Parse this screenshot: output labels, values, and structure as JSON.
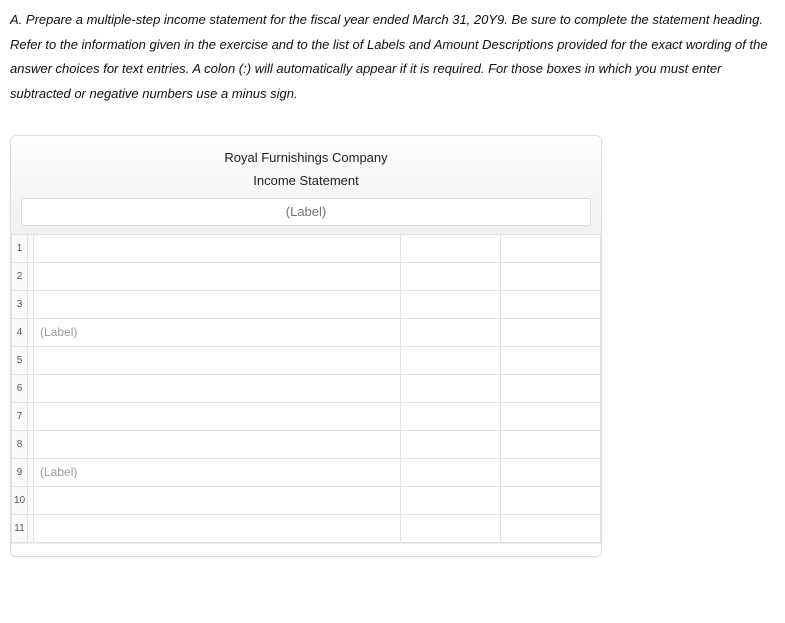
{
  "instructions": "A. Prepare a multiple-step income statement for the fiscal year ended March 31, 20Y9. Be sure to complete the statement heading. Refer to the information given in the exercise and to the list of Labels and Amount Descriptions provided for the exact wording of the answer choices for text entries. A colon (:) will automatically appear if it is required. For those boxes in which you must enter subtracted or negative numbers use a minus sign.",
  "statement": {
    "company": "Royal Furnishings Company",
    "title": "Income Statement",
    "heading_placeholder": "(Label)",
    "rows": [
      {
        "num": "1",
        "desc": "",
        "amt1": "",
        "amt2": ""
      },
      {
        "num": "2",
        "desc": "",
        "amt1": "",
        "amt2": ""
      },
      {
        "num": "3",
        "desc": "",
        "amt1": "",
        "amt2": ""
      },
      {
        "num": "4",
        "desc": "(Label)",
        "amt1": "",
        "amt2": ""
      },
      {
        "num": "5",
        "desc": "",
        "amt1": "",
        "amt2": ""
      },
      {
        "num": "6",
        "desc": "",
        "amt1": "",
        "amt2": ""
      },
      {
        "num": "7",
        "desc": "",
        "amt1": "",
        "amt2": ""
      },
      {
        "num": "8",
        "desc": "",
        "amt1": "",
        "amt2": ""
      },
      {
        "num": "9",
        "desc": "(Label)",
        "amt1": "",
        "amt2": ""
      },
      {
        "num": "10",
        "desc": "",
        "amt1": "",
        "amt2": ""
      },
      {
        "num": "11",
        "desc": "",
        "amt1": "",
        "amt2": ""
      }
    ]
  }
}
